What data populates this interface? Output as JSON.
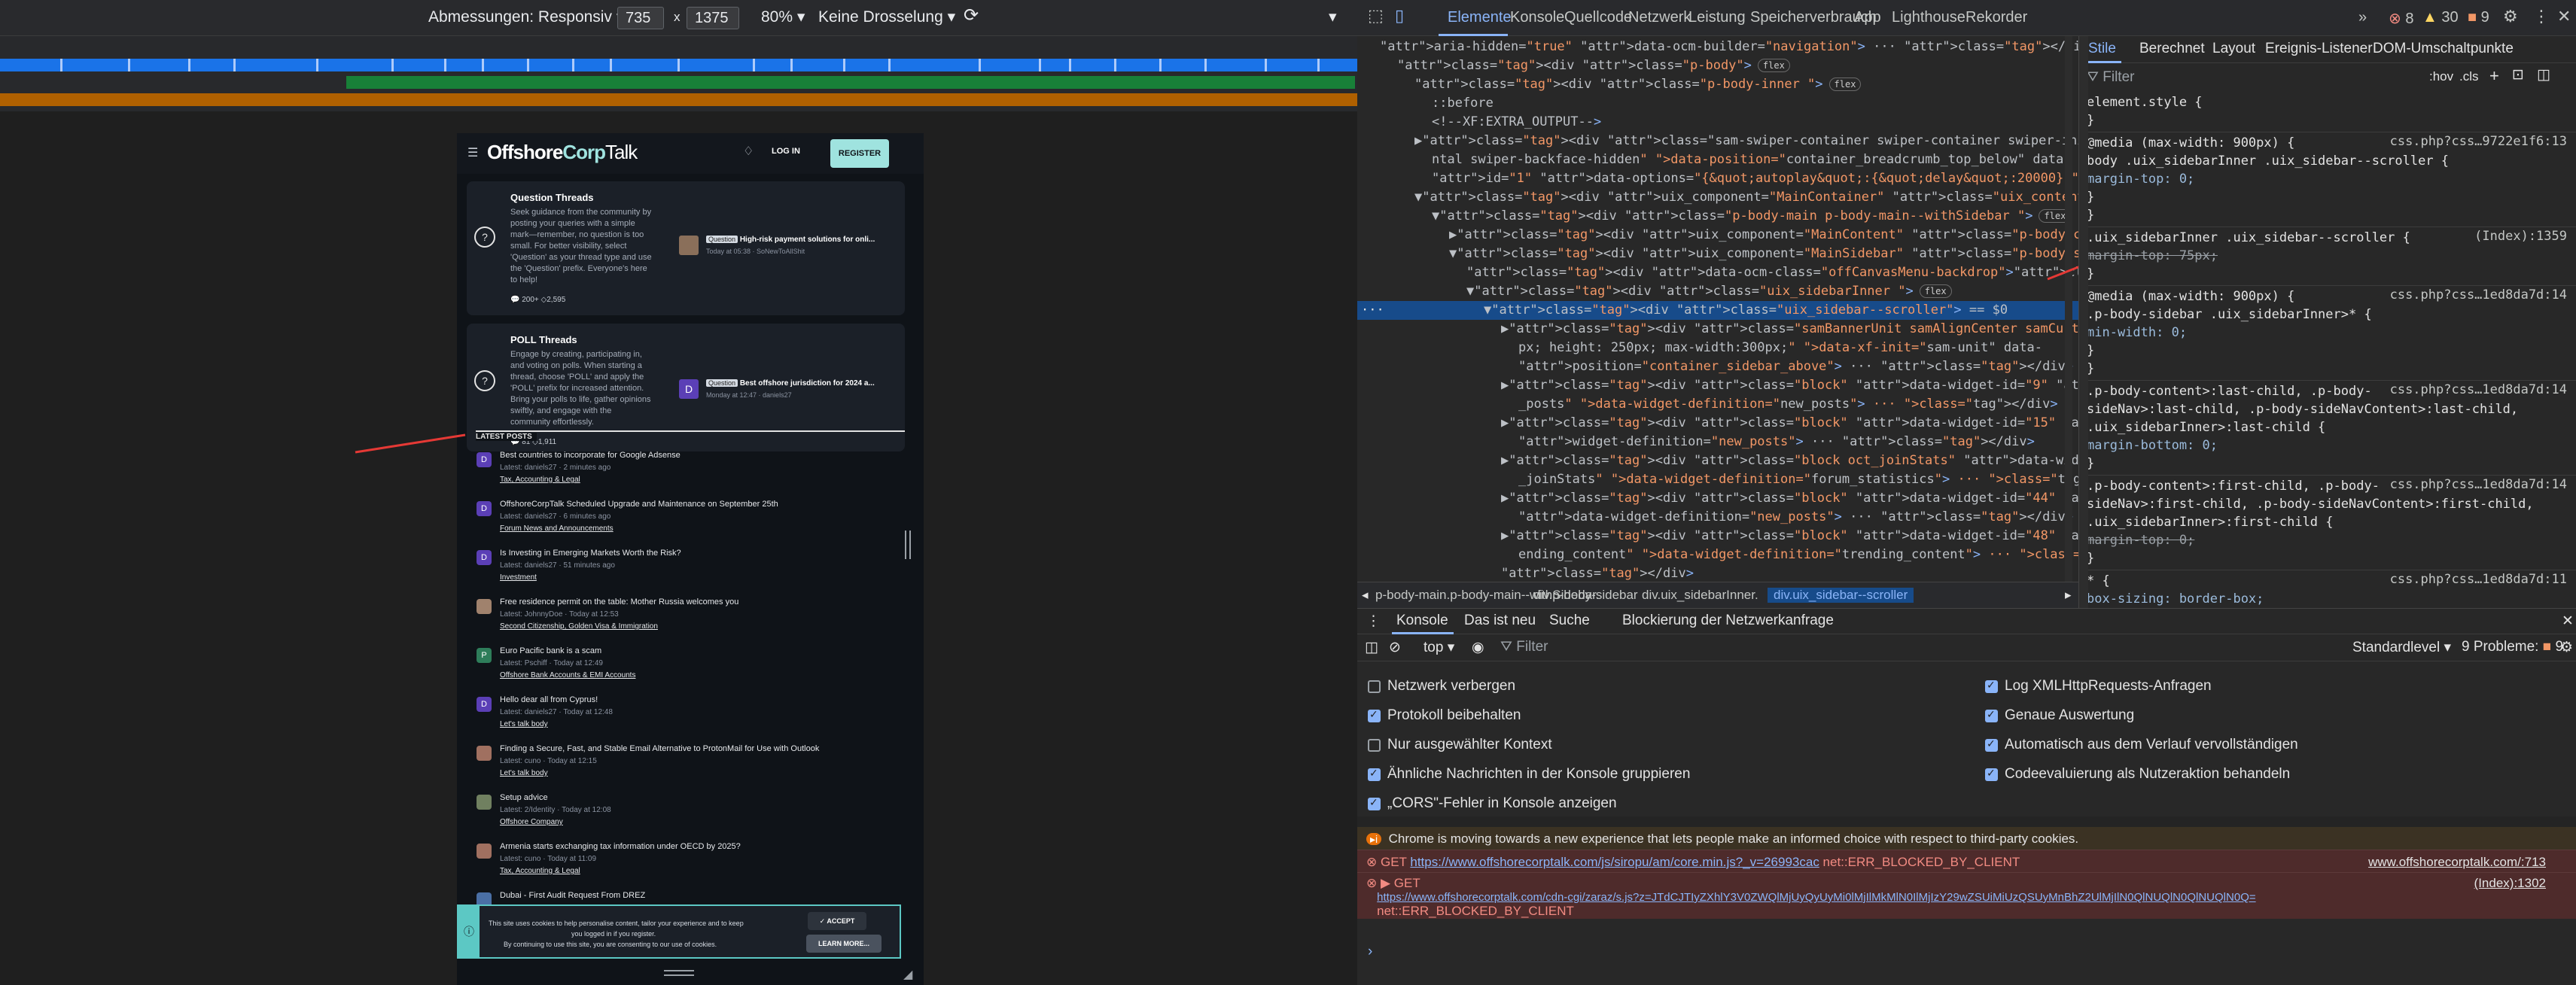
{
  "device_toolbar": {
    "dimensions_label": "Abmessungen: Responsiv",
    "width": "735",
    "x_sep": "x",
    "height": "1375",
    "zoom": "80%",
    "throttle": "Keine Drosselung"
  },
  "site": {
    "logo_offshore": "Offshore",
    "logo_corp": "Corp",
    "logo_talk": "Talk",
    "login": "LOG IN",
    "register": "REGISTER",
    "card1": {
      "title": "Question Threads",
      "lines": [
        "Seek guidance from the community by",
        "posting your queries with a simple",
        "mark—remember, no question is too",
        "small. For better visibility, select",
        "'Question' as your thread type and use",
        "the 'Question' prefix. Everyone's here",
        "to help!"
      ],
      "stats": "200+  ◇2,595",
      "prefix": "Question",
      "thread": "High-risk payment solutions for onli...",
      "meta": "Today at 05:38 · SoNewToAllShit"
    },
    "card2": {
      "title": "POLL Threads",
      "lines": [
        "Engage by creating, participating in,",
        "and voting on polls. When starting a",
        "thread, choose 'POLL' and apply the",
        "'POLL' prefix for increased attention.",
        "Bring your polls to life, gather opinions",
        "swiftly, and engage with the",
        "community effortlessly."
      ],
      "stats": "81  ◇1,911",
      "prefix": "Question",
      "thread": "Best offshore jurisdiction for 2024 a...",
      "meta": "Monday at 12:47 · daniels27",
      "avatar_letter": "D"
    },
    "latest_heading": "LATEST POSTS",
    "posts": [
      {
        "title": "Best countries to incorporate for Google Adsense",
        "meta": "Latest: daniels27 · 2 minutes ago",
        "forum": "Tax, Accounting & Legal",
        "avatar": "D",
        "color": "#5b3fb6"
      },
      {
        "title": "OffshoreCorpTalk Scheduled Upgrade and Maintenance on September 25th",
        "meta": "Latest: daniels27 · 6 minutes ago",
        "forum": "Forum News and Announcements",
        "avatar": "D",
        "color": "#5b3fb6"
      },
      {
        "title": "Is Investing in Emerging Markets Worth the Risk?",
        "meta": "Latest: daniels27 · 51 minutes ago",
        "forum": "Investment",
        "avatar": "D",
        "color": "#5b3fb6"
      },
      {
        "title": "Free residence permit on the table: Mother Russia welcomes you",
        "meta": "Latest: JohnnyDoe · Today at 12:53",
        "forum": "Second Citizenship, Golden Visa & Immigration",
        "avatar": "",
        "color": "#a0826d"
      },
      {
        "title": "Euro Pacific bank is a scam",
        "meta": "Latest: Pschiff · Today at 12:49",
        "forum": "Offshore Bank Accounts & EMI Accounts",
        "avatar": "P",
        "color": "#2e7d5a"
      },
      {
        "title": "Hello dear all from Cyprus!",
        "meta": "Latest: daniels27 · Today at 12:48",
        "forum": "Let's talk body",
        "avatar": "D",
        "color": "#5b3fb6"
      },
      {
        "title": "Finding a Secure, Fast, and Stable Email Alternative to ProtonMail for Use with Outlook",
        "meta": "Latest: cuno · Today at 12:15",
        "forum": "Let's talk body",
        "avatar": "",
        "color": "#a07060"
      },
      {
        "title": "Setup advice",
        "meta": "Latest: 2/Identity · Today at 12:08",
        "forum": "Offshore Company",
        "avatar": "",
        "color": "#708060"
      },
      {
        "title": "Armenia starts exchanging tax information under OECD by 2025?",
        "meta": "Latest: cuno · Today at 11:09",
        "forum": "Tax, Accounting & Legal",
        "avatar": "",
        "color": "#a07060"
      },
      {
        "title": "Dubai - First Audit Request From DREZ",
        "meta": "",
        "forum": "",
        "avatar": "",
        "color": "#4a6fa5"
      }
    ],
    "cookie": {
      "line1": "This site uses cookies to help personalise content, tailor your experience and to keep",
      "line2": "you logged in if you register.",
      "line3": "By continuing to use this site, you are consenting to our use of cookies.",
      "accept": "✓ ACCEPT",
      "learn": "LEARN MORE..."
    }
  },
  "devtools": {
    "tabs": [
      "Elemente",
      "Konsole",
      "Quellcode",
      "Netzwerk",
      "Leistung",
      "Speicherverbrauch",
      "App",
      "Lighthouse",
      "Rekorder"
    ],
    "counts": {
      "errors": "8",
      "warnings": "30",
      "issues": "9"
    },
    "elements": [
      {
        "i": 0,
        "html": "aria-hidden=\"true\" data-ocm-builder=\"navigation\"> ··· </div>"
      },
      {
        "i": 1,
        "html": "<div class=\"p-body\">",
        "badge": "flex"
      },
      {
        "i": 2,
        "html": "<div class=\"p-body-inner \">",
        "badge": "flex"
      },
      {
        "i": 3,
        "html": "::before"
      },
      {
        "i": 3,
        "html": "<!--XF:EXTRA_OUTPUT-->"
      },
      {
        "i": 2,
        "html": "▶<div class=\"sam-swiper-container swiper-container swiper-initialized swiper-horizo"
      },
      {
        "i": 3,
        "html": "ntal swiper-backface-hidden\" data-position=\"container_breadcrumb_top_below\" data-"
      },
      {
        "i": 3,
        "html": "id=\"1\" data-options=\"{&quot;autoplay&quot;:{&quot;delay&quot;:20000}}\"> ··· </div>"
      },
      {
        "i": 2,
        "html": "▼<div uix_component=\"MainContainer\" class=\"uix_contentWrapper\">"
      },
      {
        "i": 3,
        "html": "▼<div class=\"p-body-main p-body-main--withSidebar \">",
        "badge": "flex"
      },
      {
        "i": 4,
        "html": "▶<div uix_component=\"MainContent\" class=\"p-body-content\"> ··· </div>"
      },
      {
        "i": 4,
        "html": "▼<div uix_component=\"MainSidebar\" class=\"p-body-sidebar\">"
      },
      {
        "i": 5,
        "html": "<div data-ocm-class=\"offCanvasMenu-backdrop\"></div>"
      },
      {
        "i": 5,
        "html": "▼<div class=\"uix_sidebarInner \">",
        "badge": "flex"
      },
      {
        "i": 6,
        "html": "▼<div class=\"uix_sidebar--scroller\"> == $0",
        "selected": true
      },
      {
        "i": 7,
        "html": "▶<div class=\"samBannerUnit samAlignCenter samCustomSize\" style=\"width: 300"
      },
      {
        "i": 8,
        "html": "px; height: 250px; max-width:300px;\" data-xf-init=\"sam-unit\" data-"
      },
      {
        "i": 8,
        "html": "position=\"container_sidebar_above\"> ··· </div>"
      },
      {
        "i": 7,
        "html": "▶<div class=\"block\" data-widget-id=\"9\" data-widget-key=\"forum_overview_new"
      },
      {
        "i": 8,
        "html": "_posts\" data-widget-definition=\"new_posts\"> ··· </div>"
      },
      {
        "i": 7,
        "html": "▶<div class=\"block\" data-widget-id=\"15\" data-widget-key=\"FNEWS\" data-"
      },
      {
        "i": 8,
        "html": "widget-definition=\"new_posts\"> ··· </div>"
      },
      {
        "i": 7,
        "html": "▶<div class=\"block oct_joinStats\" data-widget-id=\"42\" data-widget-key=\"oct"
      },
      {
        "i": 8,
        "html": "_joinStats\" data-widget-definition=\"forum_statistics\"> ··· </div>"
      },
      {
        "i": 7,
        "html": "▶<div class=\"block\" data-widget-id=\"44\" data-widget-key=\"marketplace\""
      },
      {
        "i": 8,
        "html": "data-widget-definition=\"new_posts\"> ··· </div>"
      },
      {
        "i": 7,
        "html": "▶<div class=\"block\" data-widget-id=\"48\" data-widget-key=\"forum_overview_tr"
      },
      {
        "i": 8,
        "html": "ending_content\" data-widget-definition=\"trending_content\"> ··· </div>"
      },
      {
        "i": 7,
        "html": "</div>"
      }
    ],
    "breadcrumbs": [
      "p-body-main.p-body-main--withSidebar.",
      "div.p-body-sidebar",
      "div.uix_sidebarInner.",
      "div.uix_sidebar--scroller"
    ],
    "style_tabs": [
      "Stile",
      "Berechnet",
      "Layout",
      "Ereignis-Listener",
      "DOM-Umschaltpunkte"
    ],
    "filter_placeholder": "Filter",
    "hov": ":hov",
    "cls": ".cls",
    "rules": [
      {
        "lines": [
          "element.style {",
          "}"
        ]
      },
      {
        "lines": [
          "@media (max-width: 900px) {",
          "body .uix_sidebarInner .uix_sidebar--scroller {",
          "  margin-top: 0;",
          "}",
          "}"
        ],
        "src": "css.php?css…9722e1f6:13"
      },
      {
        "lines": [
          ".uix_sidebarInner .uix_sidebar--scroller {",
          "  margin-top: 75px;",
          "}"
        ],
        "src": "(Index):1359",
        "strike": [
          1
        ]
      },
      {
        "lines": [
          "@media (max-width: 900px) {",
          ".p-body-sidebar .uix_sidebarInner>* {",
          "  min-width: 0;",
          "}",
          "}"
        ],
        "src": "css.php?css…1ed8da7d:14"
      },
      {
        "lines": [
          ".p-body-content>:last-child, .p-body-",
          "sideNav>:last-child, .p-body-sideNavContent>:last-child,",
          ".uix_sidebarInner>:last-child {",
          "  margin-bottom: 0;",
          "}"
        ],
        "src": "css.php?css…1ed8da7d:14"
      },
      {
        "lines": [
          ".p-body-content>:first-child, .p-body-",
          "sideNav>:first-child, .p-body-sideNavContent>:first-child,",
          ".uix_sidebarInner>:first-child {",
          "  margin-top: 0;",
          "}"
        ],
        "src": "css.php?css…1ed8da7d:14",
        "strike": [
          3
        ]
      },
      {
        "lines": [
          "* {",
          "  box-sizing: border-box;"
        ],
        "src": "css.php?css…1ed8da7d:11"
      }
    ],
    "console_tabs": [
      "Konsole",
      "Das ist neu",
      "Suche",
      "Blockierung der Netzwerkanfrage"
    ],
    "console_toolbar": {
      "context": "top",
      "filter": "Filter",
      "level": "Standardlevel",
      "issues": "9 Probleme:",
      "issue_count": "9"
    },
    "checkboxes_left": [
      {
        "label": "Netzwerk verbergen",
        "on": false
      },
      {
        "label": "Protokoll beibehalten",
        "on": true
      },
      {
        "label": "Nur ausgewählter Kontext",
        "on": false
      },
      {
        "label": "Ähnliche Nachrichten in der Konsole gruppieren",
        "on": true
      },
      {
        "label": "„CORS\"-Fehler in Konsole anzeigen",
        "on": true
      }
    ],
    "checkboxes_right": [
      {
        "label": "Log XMLHttpRequests-Anfragen",
        "on": true
      },
      {
        "label": "Genaue Auswertung",
        "on": true
      },
      {
        "label": "Automatisch aus dem Verlauf vervollständigen",
        "on": true
      },
      {
        "label": "Codeevaluierung als Nutzeraktion behandeln",
        "on": true
      }
    ],
    "messages": {
      "info": "Chrome is moving towards a new experience that lets people make an informed choice with respect to third-party cookies.",
      "err1_prefix": "GET ",
      "err1_url": "https://www.offshorecorptalk.com/js/siropu/am/core.min.js?_v=26993cac",
      "err1_suffix": " net::ERR_BLOCKED_BY_CLIENT",
      "err1_src": "www.offshorecorptalk.com/:713",
      "err2_prefix": "▶ GET",
      "err2_src": "(Index):1302",
      "err2_url": "https://www.offshorecorptalk.com/cdn-cgi/zaraz/s.js?z=JTdCJTIyZXhlY3V0ZWQlMjUyQyUyMi0lMjIlMkMlN0IlMjIzY29wZSUiMiUzQSUyMnBhZ2UlMjIlN0QlNUQlN0QlNUQlN0Q=",
      "err2_suffix": "net::ERR_BLOCKED_BY_CLIENT"
    }
  }
}
